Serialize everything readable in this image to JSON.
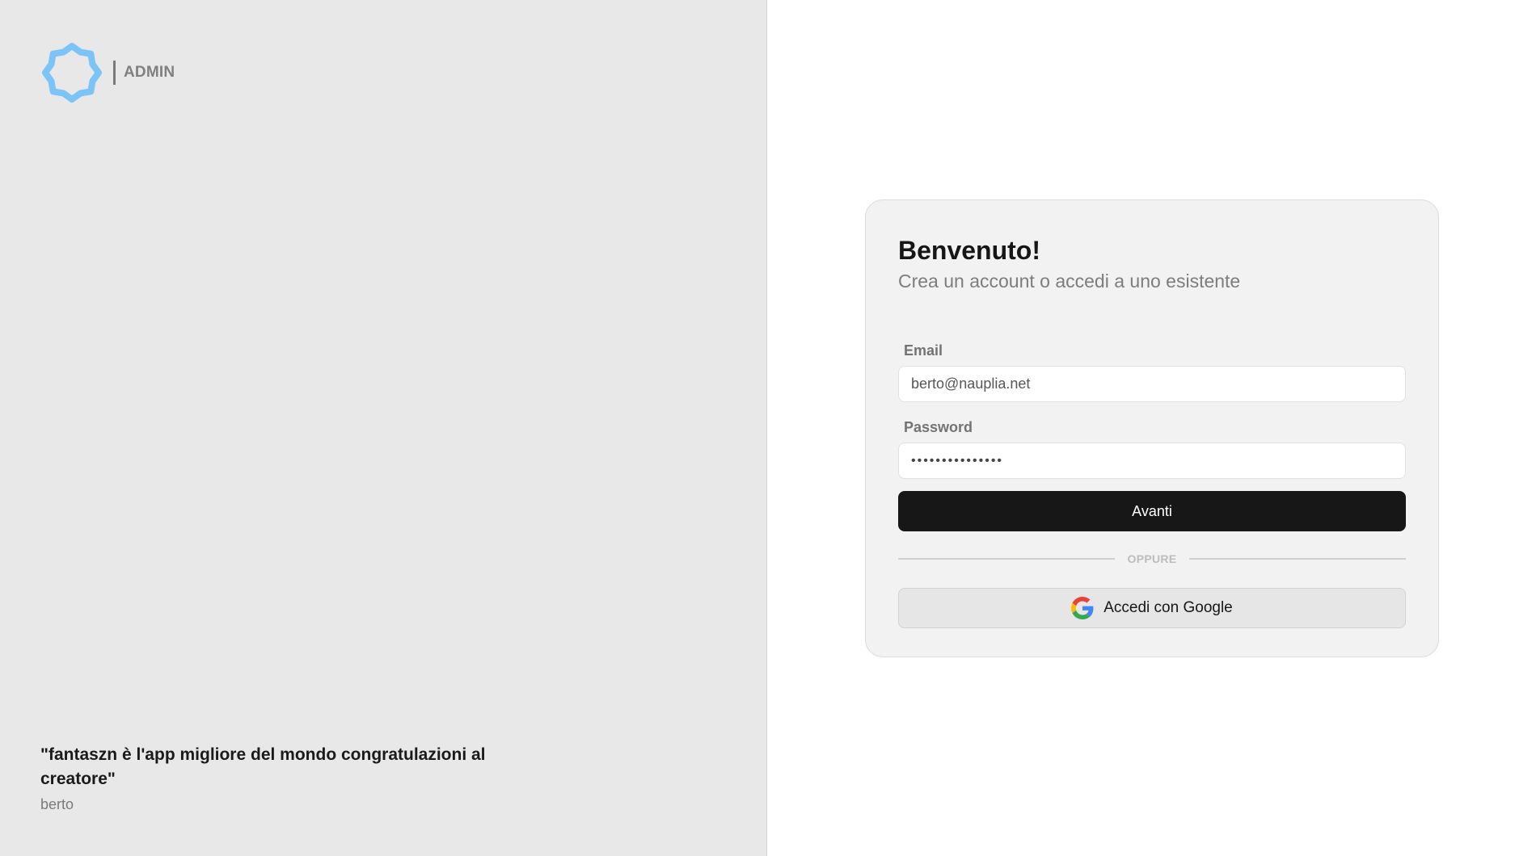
{
  "brand": {
    "logo_icon": "star-badge-icon",
    "logo_color": "#7cc4f8",
    "label": "ADMIN"
  },
  "testimonial": {
    "quote": "\"fantaszn è l'app migliore del mondo congratulazioni al creatore\"",
    "author": "berto"
  },
  "auth": {
    "title": "Benvenuto!",
    "subtitle": "Crea un account o accedi a uno esistente",
    "email": {
      "label": "Email",
      "value": "berto@nauplia.net"
    },
    "password": {
      "label": "Password",
      "masked_value": "•••••••••••••••"
    },
    "submit_label": "Avanti",
    "divider_label": "OPPURE",
    "google": {
      "label": "Accedi con Google",
      "icon": "google-icon"
    }
  },
  "colors": {
    "left_bg": "#e8e8e8",
    "card_bg": "#f2f2f2",
    "primary_button": "#171717"
  }
}
